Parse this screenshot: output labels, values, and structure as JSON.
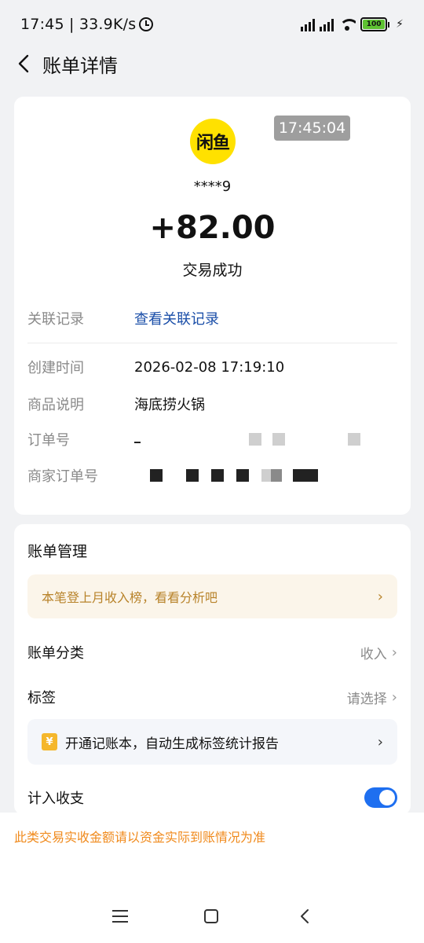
{
  "status_bar": {
    "time": "17:45",
    "net_speed": "33.9K/s",
    "battery": "100"
  },
  "header": {
    "title": "账单详情"
  },
  "summary": {
    "logo_text": "闲鱼",
    "time_badge": "17:45:04",
    "counterparty": "****9",
    "amount": "+82.00",
    "status": "交易成功"
  },
  "details": {
    "related_label": "关联记录",
    "related_link": "查看关联记录",
    "created_label": "创建时间",
    "created_value": "2026-02-08 17:19:10",
    "goods_label": "商品说明",
    "goods_value": "海底捞火锅",
    "order_label": "订单号",
    "merchant_order_label": "商家订单号"
  },
  "management": {
    "title": "账单管理",
    "promo_text": "本笔登上月收入榜，看看分析吧",
    "category_label": "账单分类",
    "category_value": "收入",
    "tag_label": "标签",
    "tag_value": "请选择",
    "tip_text": "开通记账本，自动生成标签统计报告",
    "include_label": "计入收支",
    "include_on": true
  },
  "footer": {
    "notice": "此类交易实收金额请以资金实际到账情况为准"
  },
  "colors": {
    "link": "#1a4ea8",
    "promo_text": "#b8832a",
    "notice": "#f08a1c",
    "toggle": "#1e6ff0",
    "logo": "#ffe100"
  }
}
